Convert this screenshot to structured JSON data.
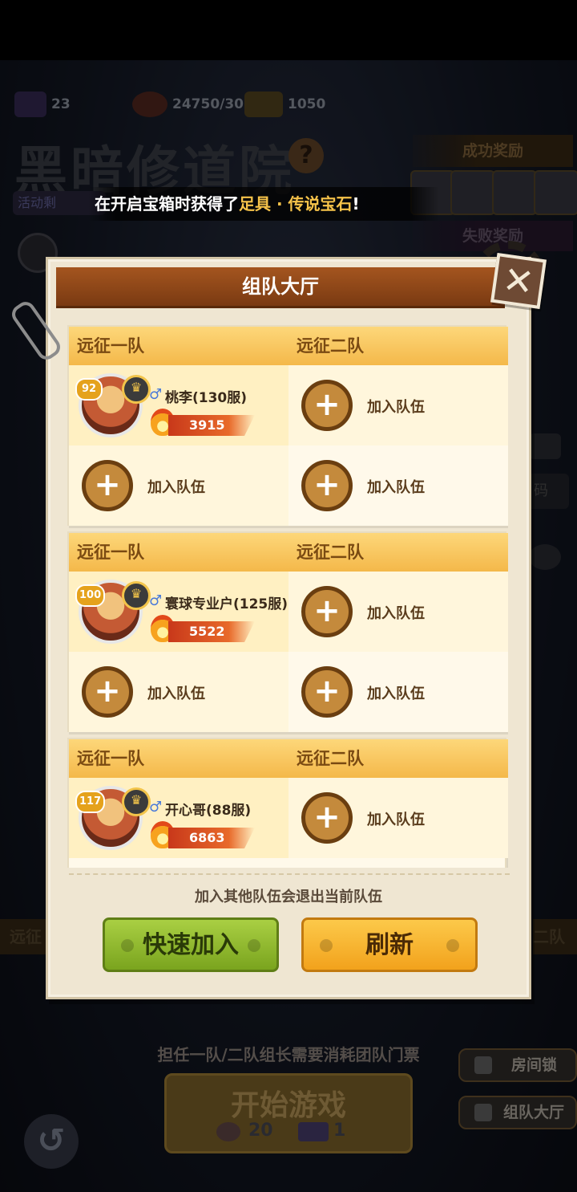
{
  "resources": {
    "tickets": "23",
    "stamina": "24750/30",
    "medals": "1050"
  },
  "background": {
    "title": "黑暗修道院",
    "question_mark": "?",
    "activity_label": "活动剩",
    "success_reward": "成功奖励",
    "fail_reward": "失败奖励",
    "code_label": "码",
    "left_banner": "远征",
    "right_banner": "二队"
  },
  "announcement": {
    "prefix": "在开启宝箱时获得了",
    "item": "足具 · 传说宝石",
    "suffix": "!"
  },
  "modal": {
    "title": "组队大厅",
    "close_icon": "✕",
    "notice": "加入其他队伍会退出当前队伍",
    "quick_join": "快速加入",
    "refresh": "刷新"
  },
  "team_headers": {
    "team1": "远征一队",
    "team2": "远征二队"
  },
  "join_label": "加入队伍",
  "plus": "+",
  "rooms": [
    {
      "leader": {
        "level": "92",
        "gender": "♂",
        "name": "桃李(130服)",
        "power": "3915"
      }
    },
    {
      "leader": {
        "level": "100",
        "gender": "♂",
        "name": "寰球专业户(125服)",
        "power": "5522"
      }
    },
    {
      "leader": {
        "level": "117",
        "gender": "♂",
        "name": "开心哥(88服)",
        "power": "6863"
      }
    }
  ],
  "bottom": {
    "ticket_note": "担任一队/二队组长需要消耗团队门票",
    "start_game": "开始游戏",
    "cost_stamina": "20",
    "cost_ticket": "1",
    "room_lock": "房间锁",
    "team_hall": "组队大厅"
  },
  "colors": {
    "accent_orange": "#f4b84a",
    "header_brown": "#a4551f",
    "quick_green": "#a9cf43",
    "refresh_yellow": "#fcc94a"
  }
}
